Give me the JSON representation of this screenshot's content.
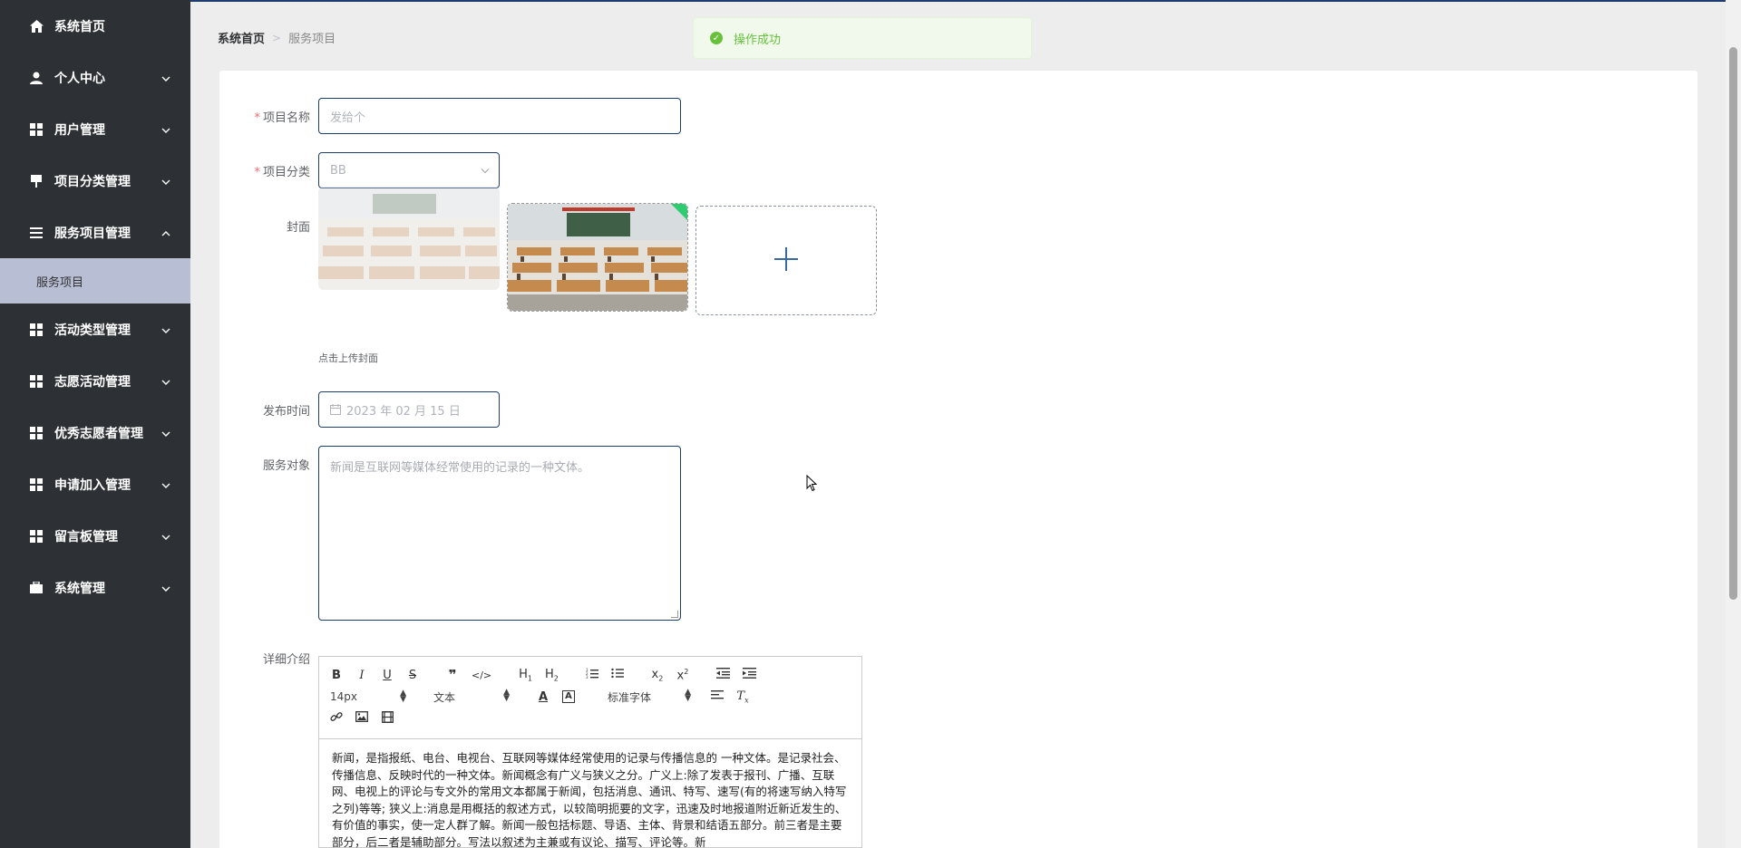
{
  "sidebar": {
    "items": [
      {
        "label": "系统首页",
        "icon": "home-icon",
        "has_arrow": false,
        "expanded": false
      },
      {
        "label": "个人中心",
        "icon": "user-icon",
        "has_arrow": true,
        "expanded": false
      },
      {
        "label": "用户管理",
        "icon": "grid-icon",
        "has_arrow": true,
        "expanded": false
      },
      {
        "label": "项目分类管理",
        "icon": "sign-icon",
        "has_arrow": true,
        "expanded": false
      },
      {
        "label": "服务项目管理",
        "icon": "list-icon",
        "has_arrow": true,
        "expanded": true
      },
      {
        "label": "活动类型管理",
        "icon": "grid-icon",
        "has_arrow": true,
        "expanded": false
      },
      {
        "label": "志愿活动管理",
        "icon": "grid-icon",
        "has_arrow": true,
        "expanded": false
      },
      {
        "label": "优秀志愿者管理",
        "icon": "grid-icon",
        "has_arrow": true,
        "expanded": false
      },
      {
        "label": "申请加入管理",
        "icon": "grid-icon",
        "has_arrow": true,
        "expanded": false
      },
      {
        "label": "留言板管理",
        "icon": "grid-icon",
        "has_arrow": true,
        "expanded": false
      },
      {
        "label": "系统管理",
        "icon": "briefcase-icon",
        "has_arrow": true,
        "expanded": false
      }
    ],
    "submenu": {
      "label": "服务项目"
    }
  },
  "breadcrumb": {
    "home": "系统首页",
    "separator": ">",
    "current": "服务项目"
  },
  "toast": {
    "message": "操作成功",
    "type": "success",
    "color": "#67c23a"
  },
  "form": {
    "name": {
      "label": "项目名称",
      "required": true,
      "placeholder": "发给个"
    },
    "category": {
      "label": "项目分类",
      "required": true,
      "value": "BB"
    },
    "cover": {
      "label": "封面",
      "hint": "点击上传封面"
    },
    "publish_time": {
      "label": "发布时间",
      "value": "2023 年 02 月 15 日"
    },
    "service_target": {
      "label": "服务对象",
      "placeholder": "新闻是互联网等媒体经常使用的记录的一种文体。"
    },
    "detail": {
      "label": "详细介绍",
      "toolbar": {
        "font_size": "14px",
        "text_style": "文本",
        "font_family": "标准字体"
      },
      "content": "新闻，是指报纸、电台、电视台、互联网等媒体经常使用的记录与传播信息的 一种文体。是记录社会、传播信息、反映时代的一种文体。新闻概念有广义与狭义之分。广义上:除了发表于报刊、广播、互联网、电视上的评论与专文外的常用文本都属于新闻，包括消息、通讯、特写、速写(有的将速写纳入特写之列)等等; 狭义上:消息是用概括的叙述方式，以较简明扼要的文字，迅速及时地报道附近新近发生的、有价值的事实，使一定人群了解。新闻一般包括标题、导语、主体、背景和结语五部分。前三者是主要部分，后二者是辅助部分。写法以叙述为主兼或有议论、描写、评论等。新"
    }
  },
  "colors": {
    "sidebar_bg": "#2d3034",
    "accent": "#1e3d6e",
    "submenu_bg": "#b8bed4"
  }
}
